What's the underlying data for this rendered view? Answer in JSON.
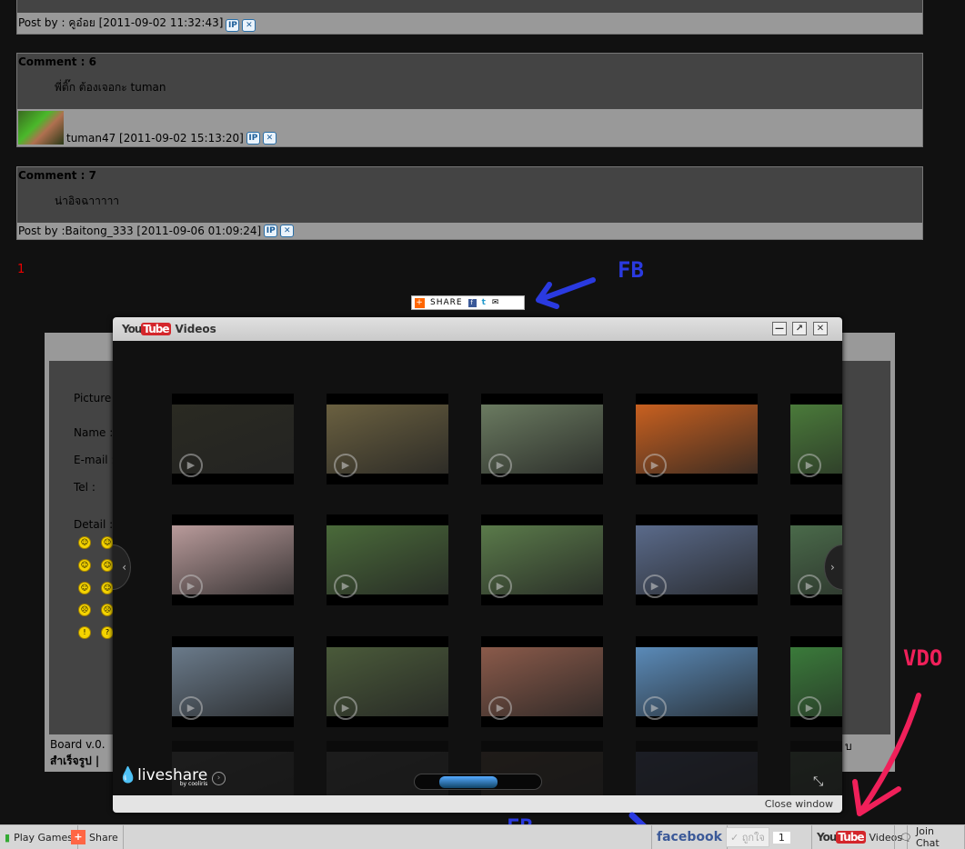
{
  "posts": [
    {
      "footer": "Post by : คูอ๋อย [2011-09-02 11:32:43]"
    },
    {
      "header": "Comment : 6",
      "text": "พี่ติ๊ก ต้องเจอกะ tuman",
      "footer": "tuman47 [2011-09-02 15:13:20]"
    },
    {
      "header": "Comment : 7",
      "text": "น่าอิจฉาาาาา",
      "footer": "Post by :Baitong_333 [2011-09-06 01:09:24]"
    }
  ],
  "icons": {
    "ip": "IP",
    "delete": "✕"
  },
  "pagination": "1",
  "share_button": {
    "label": "SHARE"
  },
  "form": {
    "labels": [
      "Picture :",
      "Name :",
      "E-mail :",
      "Tel :",
      "Detail :"
    ],
    "footer1": "Board v.0.",
    "footer2": "สำเร็จรูป |",
    "footer_right": "บ"
  },
  "modal": {
    "logo_you": "You",
    "logo_tube": "Tube",
    "title": "Videos",
    "close_window": "Close window",
    "brand": "liveshare",
    "brand_sub": "by cooliris"
  },
  "thumb_colors": [
    [
      "#2a2a22",
      "#6a6040",
      "#6a7a60",
      "#c86020",
      "#4a7a3a"
    ],
    [
      "#b89a9a",
      "#4a6a3a",
      "#5a7a4a",
      "#5a6a8a",
      "#4a6a4a"
    ],
    [
      "#6a7a8a",
      "#4a5a3a",
      "#8a5a4a",
      "#5a8ab8",
      "#3a7a3a"
    ],
    [
      "#333",
      "#333",
      "#3a3028",
      "#30354a",
      "#303a30"
    ]
  ],
  "annotations": {
    "fb_top": "FB",
    "fb_bottom": "FB",
    "vdo": "VDO"
  },
  "taskbar": {
    "play_games": "Play Games",
    "share": "Share",
    "facebook": "facebook",
    "like": "✓ ถูกใจ",
    "like_count": "1",
    "videos": "Videos",
    "join_chat": "Join Chat"
  }
}
